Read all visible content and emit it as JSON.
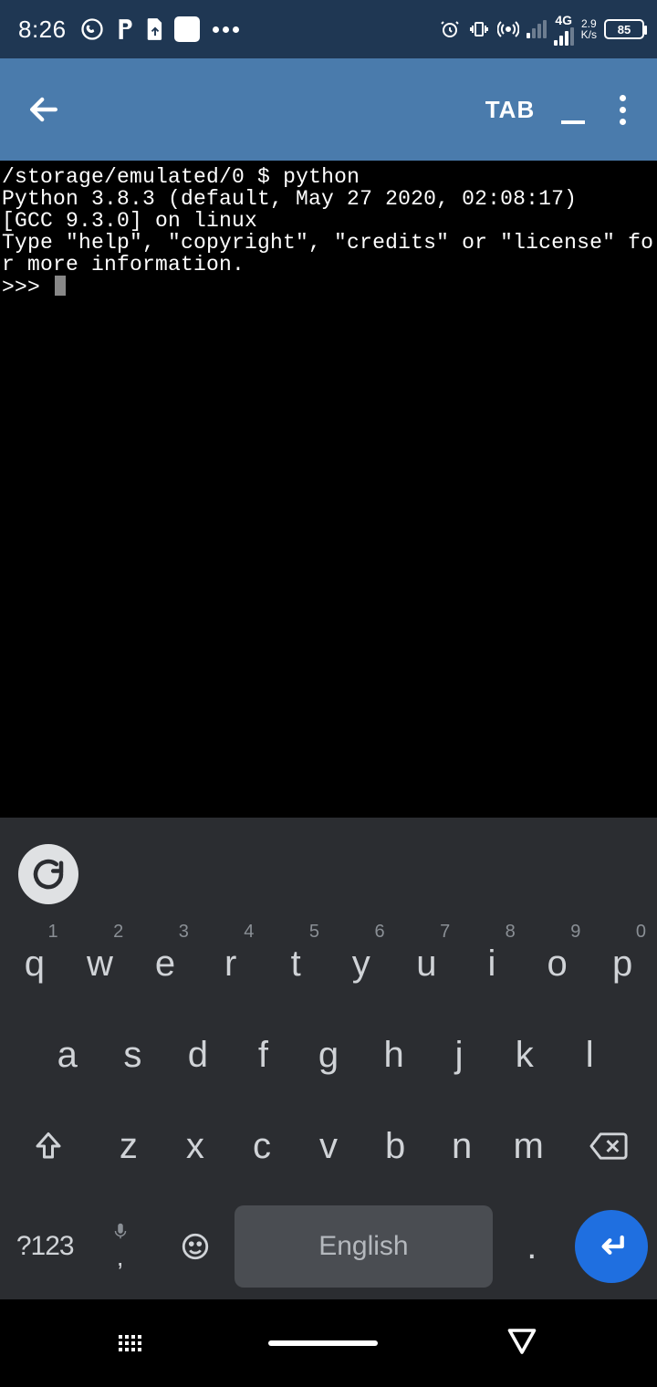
{
  "status": {
    "time": "8:26",
    "net_type": "4G",
    "speed": "2.9",
    "speed_unit": "K/s",
    "battery": "85"
  },
  "appbar": {
    "tab_label": "TAB"
  },
  "terminal": {
    "line1_path": "/storage/emulated/0 $ ",
    "line1_cmd": "python",
    "line2": "Python 3.8.3 (default, May 27 2020, 02:08:17)",
    "line3": "[GCC 9.3.0] on linux",
    "line4": "Type \"help\", \"copyright\", \"credits\" or \"license\" for more information.",
    "prompt": ">>> "
  },
  "keyboard": {
    "g_label": "G",
    "row1": [
      {
        "k": "q",
        "h": "1"
      },
      {
        "k": "w",
        "h": "2"
      },
      {
        "k": "e",
        "h": "3"
      },
      {
        "k": "r",
        "h": "4"
      },
      {
        "k": "t",
        "h": "5"
      },
      {
        "k": "y",
        "h": "6"
      },
      {
        "k": "u",
        "h": "7"
      },
      {
        "k": "i",
        "h": "8"
      },
      {
        "k": "o",
        "h": "9"
      },
      {
        "k": "p",
        "h": "0"
      }
    ],
    "row2": [
      "a",
      "s",
      "d",
      "f",
      "g",
      "h",
      "j",
      "k",
      "l"
    ],
    "row3": [
      "z",
      "x",
      "c",
      "v",
      "b",
      "n",
      "m"
    ],
    "sym_label": "?123",
    "mic_sub": ",",
    "space_label": "English",
    "period": "."
  }
}
